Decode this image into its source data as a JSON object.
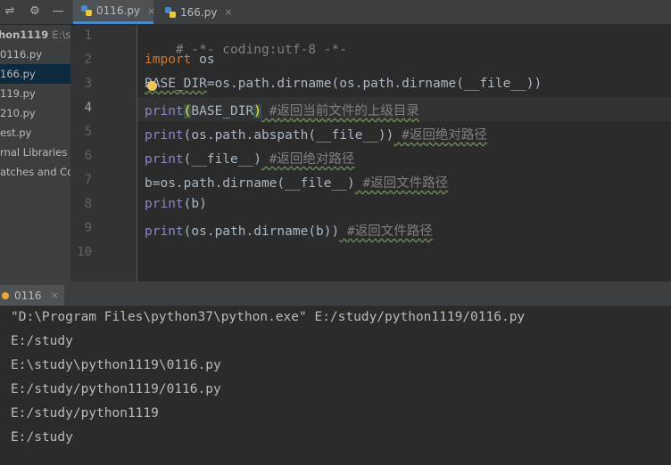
{
  "tabs": [
    {
      "label": "0116.py",
      "close": "×",
      "active": true
    },
    {
      "label": "166.py",
      "close": "×",
      "active": false
    }
  ],
  "sidebar": {
    "project": "hon1119",
    "project_path": "E:\\stu",
    "items": [
      "0116.py",
      "166.py",
      "119.py",
      "210.py",
      "est.py",
      "rnal Libraries",
      "atches and Con"
    ]
  },
  "editor": {
    "line_numbers": [
      "1",
      "2",
      "3",
      "4",
      "5",
      "6",
      "7",
      "8",
      "9",
      "10"
    ],
    "current_line": "4",
    "lines": {
      "l1": "# -*- coding:utf-8 -*-",
      "l2_kw": "import",
      "l2_rest": " os",
      "l3_var": "BASE_DIR",
      "l3_rest": "=os.path.dirname(os.path.dirname(__file__))",
      "l4_fn": "print",
      "l4_open": "(",
      "l4_arg": "BASE_DIR",
      "l4_close": ")",
      "l4_comment": " #返回当前文件的上级目录",
      "l5_fn": "print",
      "l5_rest": "(os.path.abspath(__file__))",
      "l5_comment": " #返回绝对路径",
      "l6_fn": "print",
      "l6_rest": "(__file__)",
      "l6_comment": " #返回绝对路径",
      "l7_b": "b",
      "l7_rest": "=os.path.dirname(__file__)",
      "l7_comment": " #返回文件路径",
      "l8_fn": "print",
      "l8_rest": "(b)",
      "l9_fn": "print",
      "l9_rest": "(os.path.dirname(b))",
      "l9_comment": " #返回文件路径"
    }
  },
  "run": {
    "tab_label": "0116",
    "close": "×",
    "output": [
      "\"D:\\Program Files\\python37\\python.exe\" E:/study/python1119/0116.py",
      "E:/study",
      "E:\\study\\python1119\\0116.py",
      "E:/study/python1119/0116.py",
      "E:/study/python1119",
      "E:/study"
    ]
  },
  "colors": {
    "keyword": "#cc7832",
    "builtin": "#8888c6",
    "comment": "#808080",
    "text": "#a9b7c6",
    "background": "#2b2b2b"
  }
}
